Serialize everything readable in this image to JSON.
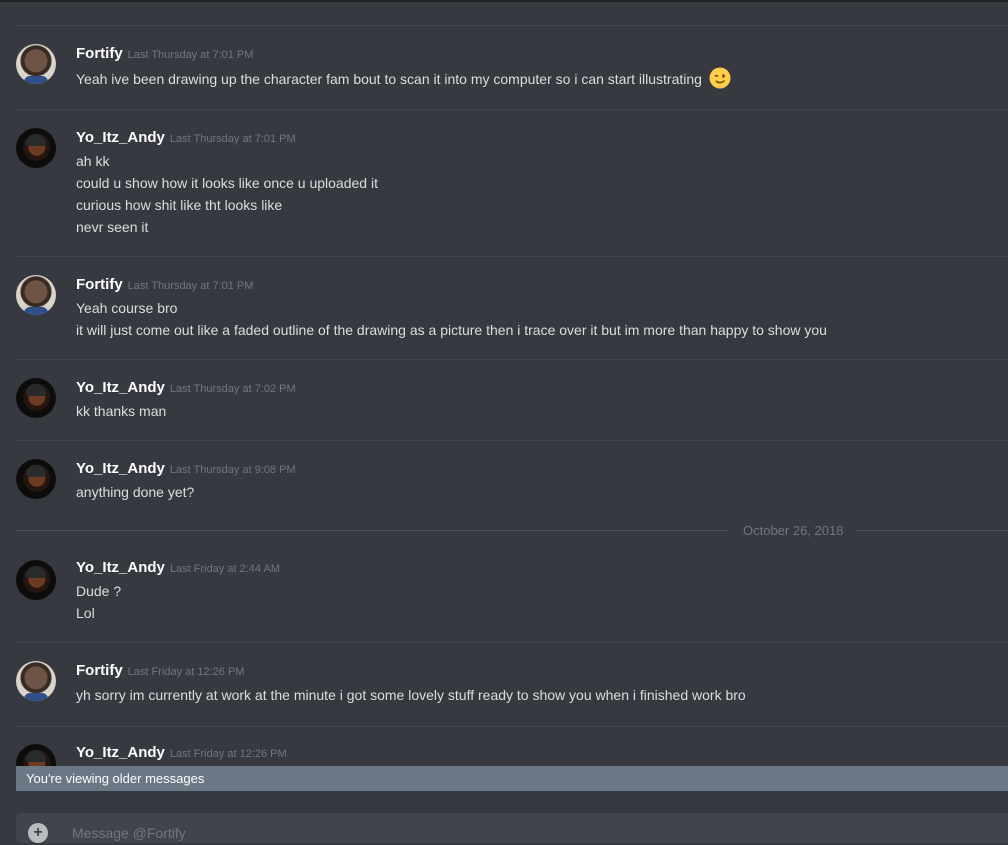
{
  "messages": [
    {
      "author": "Fortify",
      "avatar": "fortify-avatar",
      "timestamp": "Last Thursday at 7:01 PM",
      "lines": [
        "Yeah ive been drawing up the character fam bout to scan it into my computer so i can start illustrating"
      ],
      "emoji": "wink-emoji"
    },
    {
      "author": "Yo_Itz_Andy",
      "avatar": "andy-avatar",
      "timestamp": "Last Thursday at 7:01 PM",
      "lines": [
        "ah kk",
        "could u show how it looks like once u uploaded it",
        "curious how shit like tht looks like",
        "nevr seen it"
      ]
    },
    {
      "author": "Fortify",
      "avatar": "fortify-avatar",
      "timestamp": "Last Thursday at 7:01 PM",
      "lines": [
        "Yeah course bro",
        "it will just come out like a faded outline of the drawing as a picture then i trace over it but im more than happy to show you"
      ]
    },
    {
      "author": "Yo_Itz_Andy",
      "avatar": "andy-avatar",
      "timestamp": "Last Thursday at 7:02 PM",
      "lines": [
        "kk thanks man"
      ]
    },
    {
      "author": "Yo_Itz_Andy",
      "avatar": "andy-avatar",
      "timestamp": "Last Thursday at 9:08 PM",
      "lines": [
        "anything done yet?"
      ]
    },
    {
      "author": "Yo_Itz_Andy",
      "avatar": "andy-avatar",
      "timestamp": "Last Friday at 2:44 AM",
      "lines": [
        "Dude ?",
        "Lol"
      ]
    },
    {
      "author": "Fortify",
      "avatar": "fortify-avatar",
      "timestamp": "Last Friday at 12:26 PM",
      "lines": [
        "yh sorry im currently at work at the minute i got some lovely stuff ready to show you when i finished work bro"
      ]
    },
    {
      "author": "Yo_Itz_Andy",
      "avatar": "andy-avatar",
      "timestamp": "Last Friday at 12:26 PM",
      "lines": []
    }
  ],
  "date_divider": "October 26, 2018",
  "older_messages_bar": "You're viewing older messages",
  "composer": {
    "placeholder": "Message @Fortify",
    "upload_icon": "plus-icon"
  },
  "colors": {
    "background": "#36393f",
    "username": "#ffffff",
    "timestamp": "#72767d",
    "banner": "#6c7786"
  }
}
